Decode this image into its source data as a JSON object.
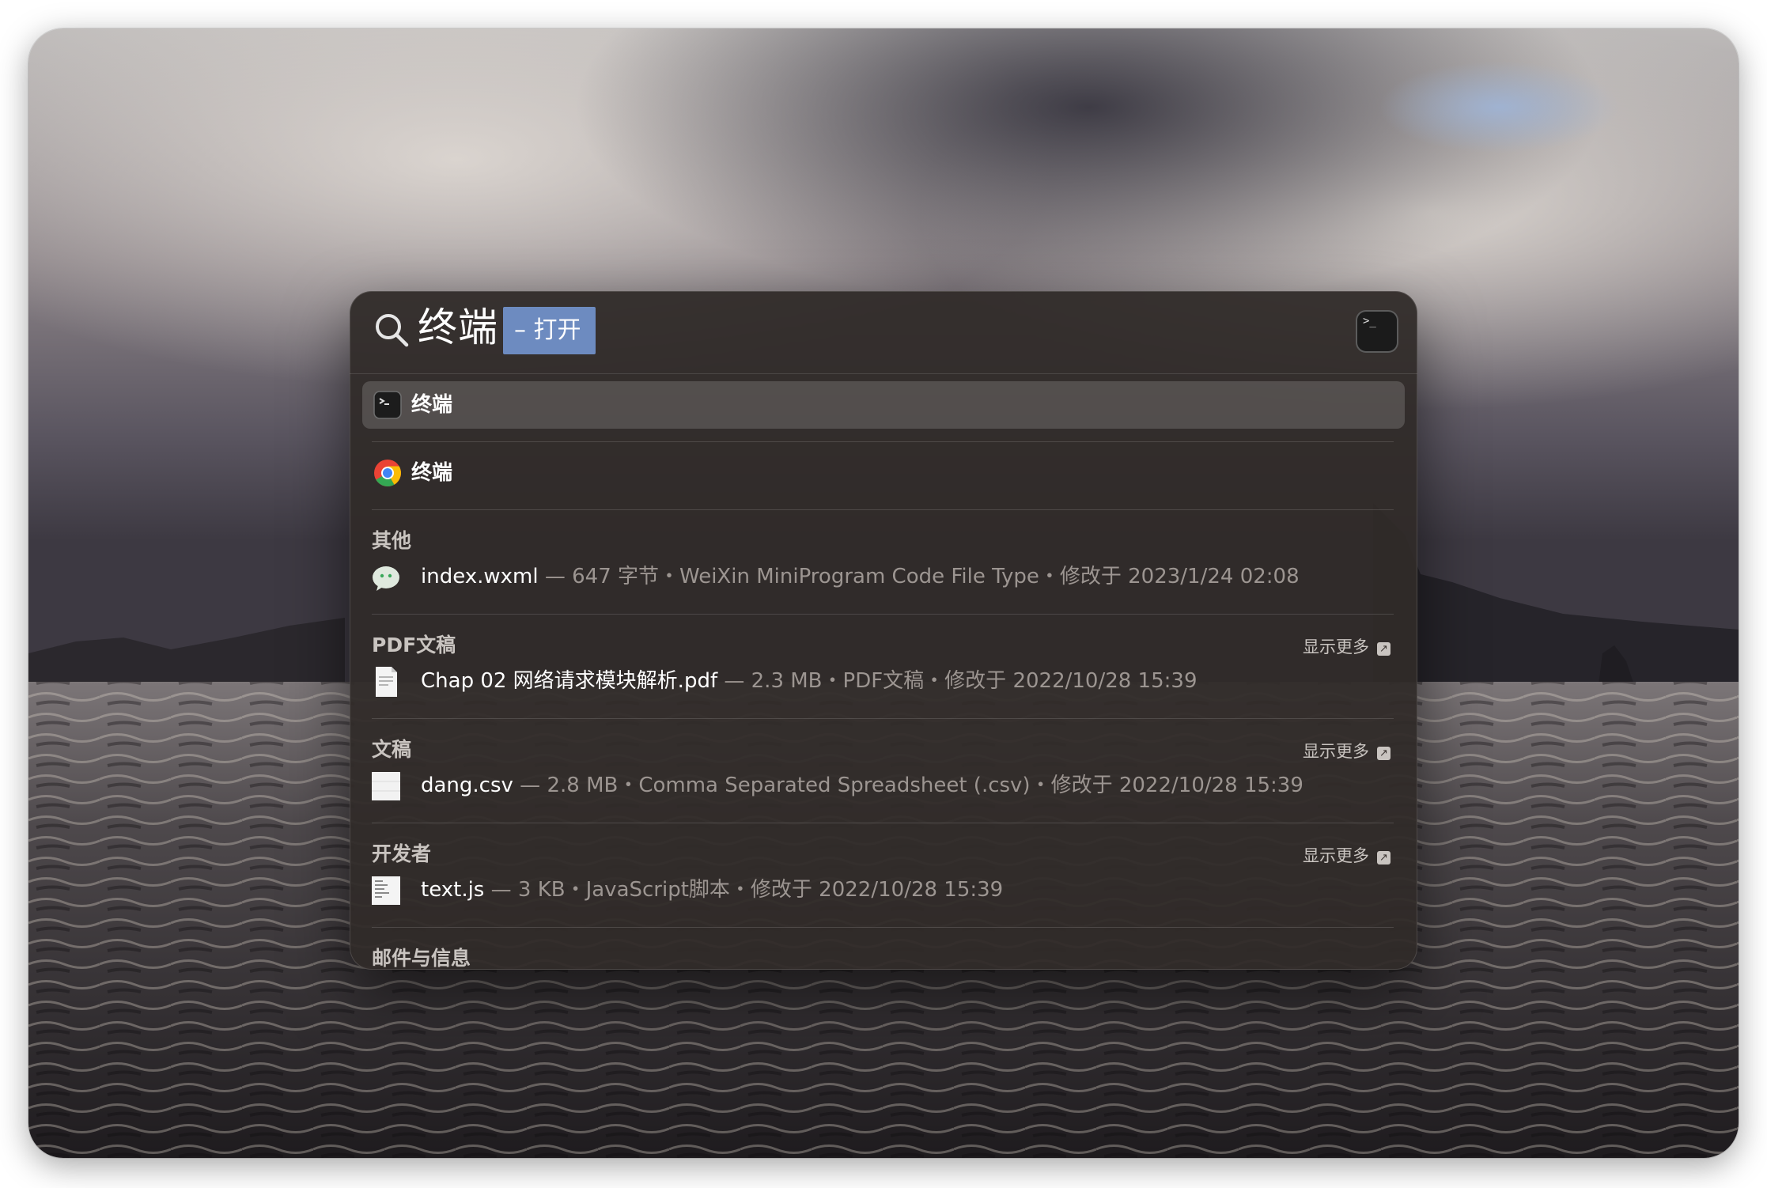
{
  "spotlight": {
    "query": "终端",
    "completion": "– 打开",
    "preview_icon": "terminal-icon"
  },
  "top_hits": [
    {
      "label": "终端",
      "icon": "terminal-app-icon",
      "selected": true
    },
    {
      "label": "终端",
      "icon": "chrome-icon",
      "selected": false
    }
  ],
  "sections": [
    {
      "title": "其他",
      "show_more": "",
      "result": {
        "name": "index.wxml",
        "meta": " — 647 字节・WeiXin MiniProgram Code File Type・修改于 2023/1/24 02:08",
        "icon": "wechat-file-icon"
      }
    },
    {
      "title": "PDF文稿",
      "show_more": "显示更多",
      "result": {
        "name": "Chap 02 网络请求模块解析.pdf",
        "meta": " — 2.3 MB・PDF文稿・修改于 2022/10/28 15:39",
        "icon": "pdf-file-icon"
      }
    },
    {
      "title": "文稿",
      "show_more": "显示更多",
      "result": {
        "name": "dang.csv",
        "meta": " — 2.8 MB・Comma Separated Spreadsheet (.csv)・修改于 2022/10/28 15:39",
        "icon": "csv-file-icon"
      }
    },
    {
      "title": "开发者",
      "show_more": "显示更多",
      "result": {
        "name": "text.js",
        "meta": " — 3 KB・JavaScript脚本・修改于 2022/10/28 15:39",
        "icon": "js-file-icon"
      }
    },
    {
      "title": "邮件与信息",
      "show_more": "",
      "result": null
    }
  ],
  "prompt_glyph": ">_"
}
